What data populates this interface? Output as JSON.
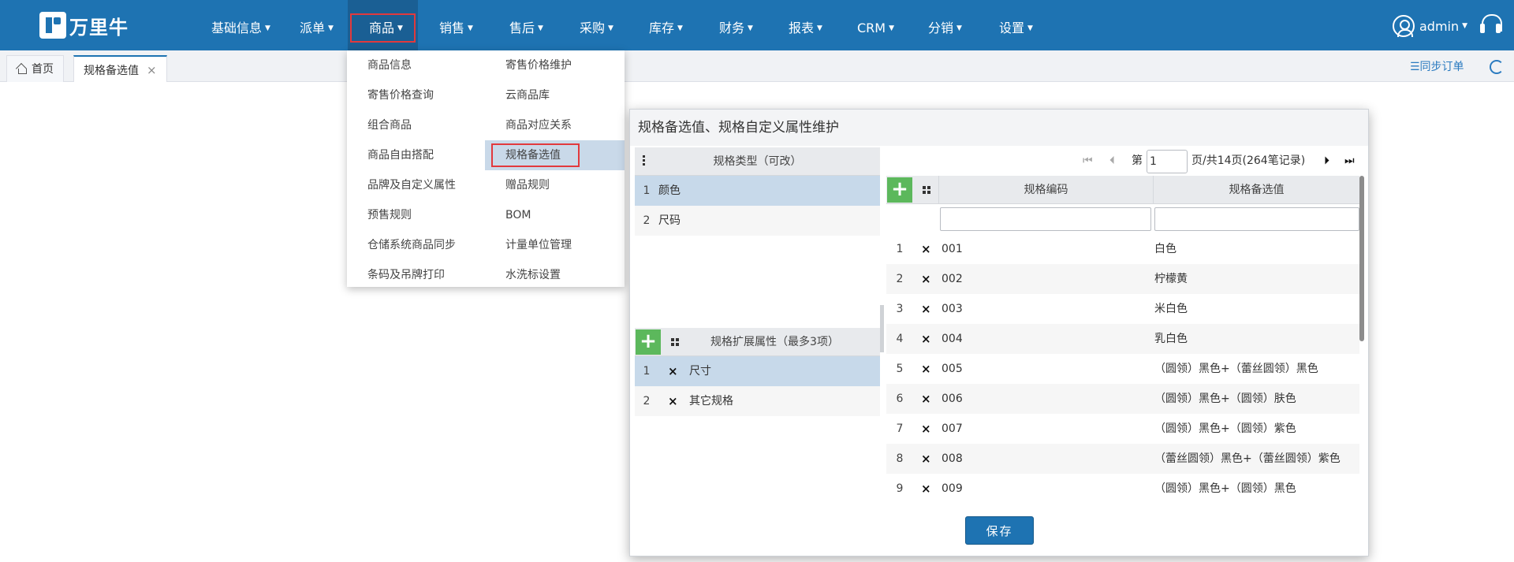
{
  "brand": {
    "name": "万里牛"
  },
  "nav": [
    {
      "label": "基础信息"
    },
    {
      "label": "派单"
    },
    {
      "label": "商品"
    },
    {
      "label": "销售"
    },
    {
      "label": "售后"
    },
    {
      "label": "采购"
    },
    {
      "label": "库存"
    },
    {
      "label": "财务"
    },
    {
      "label": "报表"
    },
    {
      "label": "CRM"
    },
    {
      "label": "分销"
    },
    {
      "label": "设置"
    }
  ],
  "caret": "▼",
  "user": {
    "name": "admin"
  },
  "tabs": [
    {
      "label": "首页"
    },
    {
      "label": "规格备选值"
    }
  ],
  "tab_close": "×",
  "sync_label": "☰同步订单",
  "dropdown": {
    "left": [
      "商品信息",
      "寄售价格查询",
      "组合商品",
      "商品自由搭配",
      "品牌及自定义属性",
      "预售规则",
      "仓储系统商品同步",
      "条码及吊牌打印"
    ],
    "right": [
      "寄售价格维护",
      "云商品库",
      "商品对应关系",
      "规格备选值",
      "赠品规则",
      "BOM",
      "计量单位管理",
      "水洗标设置"
    ]
  },
  "modal": {
    "title": "规格备选值、规格自定义属性维护",
    "spec_types": {
      "header": "规格类型（可改）",
      "rows": [
        {
          "no": "1",
          "name": "颜色"
        },
        {
          "no": "2",
          "name": "尺码"
        }
      ]
    },
    "ext_attrs": {
      "header": "规格扩展属性（最多3项）",
      "rows": [
        {
          "no": "1",
          "name": "尺寸"
        },
        {
          "no": "2",
          "name": "其它规格"
        }
      ]
    },
    "pager": {
      "prefix": "第",
      "page": "1",
      "suffix": "页/共14页(264笔记录)"
    },
    "values_table": {
      "col_code": "规格编码",
      "col_value": "规格备选值",
      "rows": [
        {
          "no": "1",
          "code": "001",
          "value": "白色"
        },
        {
          "no": "2",
          "code": "002",
          "value": "柠檬黄"
        },
        {
          "no": "3",
          "code": "003",
          "value": "米白色"
        },
        {
          "no": "4",
          "code": "004",
          "value": "乳白色"
        },
        {
          "no": "5",
          "code": "005",
          "value": "（圆领）黑色+（蕾丝圆领）黑色"
        },
        {
          "no": "6",
          "code": "006",
          "value": "（圆领）黑色+（圆领）肤色"
        },
        {
          "no": "7",
          "code": "007",
          "value": "（圆领）黑色+（圆领）紫色"
        },
        {
          "no": "8",
          "code": "008",
          "value": "（蕾丝圆领）黑色+（蕾丝圆领）紫色"
        },
        {
          "no": "9",
          "code": "009",
          "value": "（圆领）黑色+（圆领）黑色"
        }
      ]
    },
    "save_label": "保存",
    "delete_glyph": "×",
    "add_glyph": "+"
  },
  "colors": {
    "primary": "#1e73b2",
    "add_green": "#5cb85c",
    "highlight_red": "#e2393d",
    "selected_row": "#c7d9ea"
  }
}
